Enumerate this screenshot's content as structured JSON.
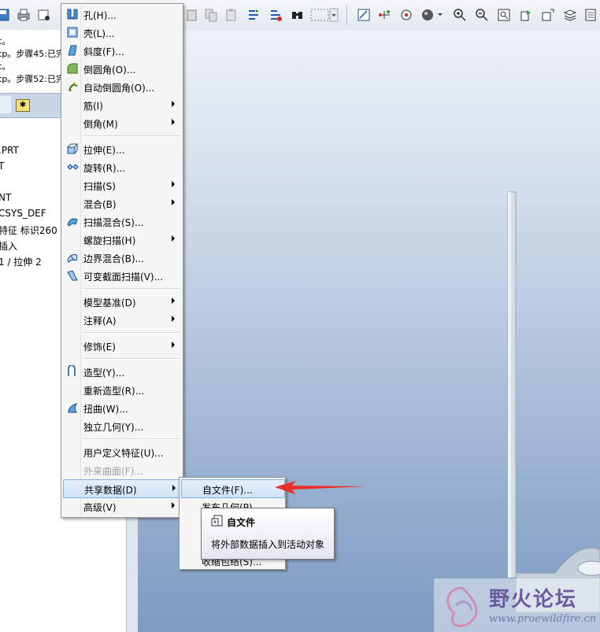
{
  "messages": [
    "t。",
    "tp。步骤45:已完",
    "t。",
    "tp。步骤52:已完"
  ],
  "tree": {
    "items": [
      ".PRT",
      "T",
      "NT",
      "CSYS_DEF",
      "特征 标识260",
      "插入",
      "1 / 拉伸 2"
    ]
  },
  "menu": {
    "items": [
      {
        "label": "孔(H)...",
        "icon": "hole-icon"
      },
      {
        "label": "壳(L)...",
        "icon": "shell-icon"
      },
      {
        "label": "斜度(F)...",
        "icon": "draft-icon"
      },
      {
        "label": "倒圆角(O)...",
        "icon": "round-icon"
      },
      {
        "label": "自动倒圆角(O)...",
        "icon": "auto-round-icon"
      },
      {
        "label": "筋(I)",
        "icon": ""
      },
      {
        "label": "倒角(M)",
        "icon": ""
      },
      {
        "label": "拉伸(E)...",
        "icon": "extrude-icon"
      },
      {
        "label": "旋转(R)...",
        "icon": "revolve-icon"
      },
      {
        "label": "扫描(S)",
        "icon": ""
      },
      {
        "label": "混合(B)",
        "icon": ""
      },
      {
        "label": "扫描混合(S)...",
        "icon": "swept-blend-icon"
      },
      {
        "label": "螺旋扫描(H)",
        "icon": ""
      },
      {
        "label": "边界混合(B)...",
        "icon": "boundary-blend-icon"
      },
      {
        "label": "可变截面扫描(V)...",
        "icon": "variable-sweep-icon"
      },
      {
        "label": "模型基准(D)",
        "icon": ""
      },
      {
        "label": "注释(A)",
        "icon": ""
      },
      {
        "label": "修饰(E)",
        "icon": ""
      },
      {
        "label": "造型(Y)...",
        "icon": "style-icon"
      },
      {
        "label": "重新造型(R)...",
        "icon": ""
      },
      {
        "label": "扭曲(W)...",
        "icon": "warp-icon"
      },
      {
        "label": "独立几何(Y)...",
        "icon": ""
      },
      {
        "label": "用户定义特征(U)...",
        "icon": ""
      },
      {
        "label": "外来曲面(F)...",
        "icon": ""
      },
      {
        "label": "共享数据(D)",
        "icon": ""
      },
      {
        "label": "高级(V)",
        "icon": ""
      }
    ]
  },
  "submenu": {
    "items": [
      "自文件(F)...",
      "发布几何(P)...",
      "",
      "",
      "收缩包络(S)..."
    ]
  },
  "tooltip": {
    "title": "自文件",
    "description": "将外部数据插入到活动对象"
  },
  "watermark": {
    "title": "野火论坛",
    "url": "www.proewildfire.cn"
  },
  "colors": {
    "highlight": "#cfe2f8",
    "arrow": "#e8302a"
  }
}
